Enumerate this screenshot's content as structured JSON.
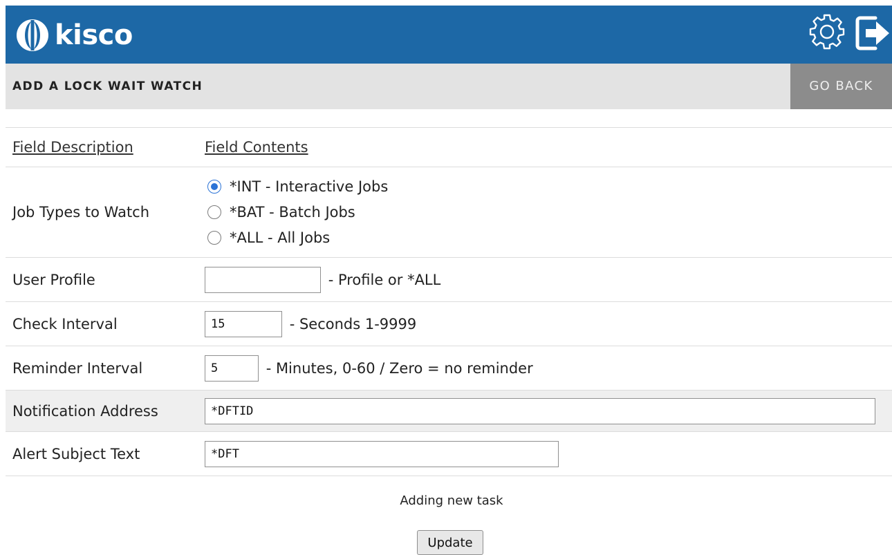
{
  "brand": {
    "name": "kisco",
    "color": "#1d68a6"
  },
  "header": {
    "settings_icon": "gear-icon",
    "logout_icon": "sign-out-icon"
  },
  "subbar": {
    "title": "ADD A LOCK WAIT WATCH",
    "back_label": "GO BACK"
  },
  "table": {
    "headers": {
      "description": "Field Description",
      "contents": "Field Contents"
    },
    "job_types": {
      "label": "Job Types to Watch",
      "options": [
        {
          "label": "*INT - Interactive Jobs",
          "checked": true
        },
        {
          "label": "*BAT - Batch Jobs",
          "checked": false
        },
        {
          "label": "*ALL - All Jobs",
          "checked": false
        }
      ]
    },
    "user_profile": {
      "label": "User Profile",
      "value": "",
      "suffix": "- Profile or *ALL"
    },
    "check_interval": {
      "label": "Check Interval",
      "value": "15",
      "suffix": "- Seconds 1-9999"
    },
    "reminder_interval": {
      "label": "Reminder Interval",
      "value": "5",
      "suffix": "- Minutes, 0-60 / Zero = no reminder"
    },
    "notification_address": {
      "label": "Notification Address",
      "value": "*DFTID"
    },
    "alert_subject": {
      "label": "Alert Subject Text",
      "value": "*DFT"
    }
  },
  "status_text": "Adding new task",
  "update_label": "Update"
}
